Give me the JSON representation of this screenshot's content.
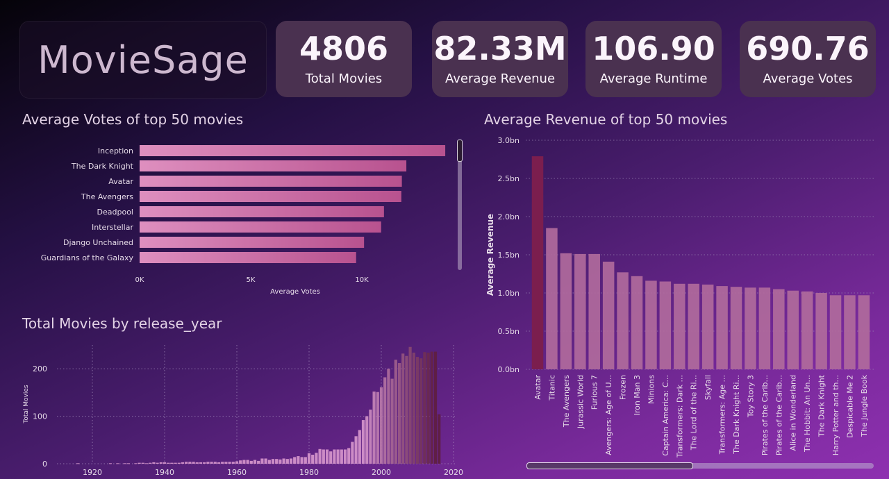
{
  "app": {
    "title": "MovieSage"
  },
  "kpis": [
    {
      "value": "4806",
      "label": "Total Movies"
    },
    {
      "value": "82.33M",
      "label": "Average Revenue"
    },
    {
      "value": "106.90",
      "label": "Average Runtime"
    },
    {
      "value": "690.76",
      "label": "Average Votes"
    }
  ],
  "colors": {
    "bar_light": "#de8fbf",
    "bar_dark": "#b8528f",
    "highlight": "#7b1e4e",
    "tick": "#e6dbe8"
  },
  "chart_data": [
    {
      "type": "bar",
      "orientation": "horizontal",
      "title": "Average Votes of top 50 movies",
      "xlabel": "Average Votes",
      "ylabel": "",
      "xlim": [
        0,
        13000
      ],
      "x_ticks": [
        "0K",
        "5K",
        "10K"
      ],
      "x_tick_values": [
        0,
        5000,
        10000
      ],
      "grid": false,
      "categories": [
        "Inception",
        "The Dark Knight",
        "Avatar",
        "The Avengers",
        "Deadpool",
        "Interstellar",
        "Django Unchained",
        "Guardians of the Galaxy"
      ],
      "values": [
        13752,
        12002,
        11800,
        11776,
        10995,
        10867,
        10099,
        9742
      ]
    },
    {
      "type": "bar",
      "title": "Average Revenue of top 50 movies",
      "xlabel": "",
      "ylabel": "Average Revenue",
      "ylim": [
        0,
        3.0
      ],
      "y_ticks": [
        "0.0bn",
        "0.5bn",
        "1.0bn",
        "1.5bn",
        "2.0bn",
        "2.5bn",
        "3.0bn"
      ],
      "grid": true,
      "categories": [
        "Avatar",
        "Titanic",
        "The Avengers",
        "Jurassic World",
        "Furious 7",
        "Avengers: Age of U...",
        "Frozen",
        "Iron Man 3",
        "Minions",
        "Captain America: C...",
        "Transformers: Dark ...",
        "The Lord of the Ri...",
        "Skyfall",
        "Transformers: Age ...",
        "The Dark Knight Ri...",
        "Toy Story 3",
        "Pirates of the Carib...",
        "Pirates of the Carib...",
        "Alice in Wonderland",
        "The Hobbit: An Un...",
        "The Dark Knight",
        "Harry Potter and th...",
        "Despicable Me 2",
        "The Jungle Book"
      ],
      "values": [
        2.79,
        1.85,
        1.52,
        1.51,
        1.51,
        1.41,
        1.27,
        1.22,
        1.16,
        1.15,
        1.12,
        1.12,
        1.11,
        1.09,
        1.08,
        1.07,
        1.07,
        1.05,
        1.03,
        1.02,
        1.0,
        0.97,
        0.97,
        0.97
      ]
    },
    {
      "type": "bar",
      "title": "Total Movies by release_year",
      "xlabel": "",
      "ylabel": "Total Movies",
      "ylim": [
        0,
        250
      ],
      "xlim": [
        1910,
        2020
      ],
      "x_ticks": [
        "1920",
        "1940",
        "1960",
        "1980",
        "2000",
        "2020"
      ],
      "x_tick_values": [
        1920,
        1940,
        1960,
        1980,
        2000,
        2020
      ],
      "y_ticks": [
        "0",
        "100",
        "200"
      ],
      "y_tick_values": [
        0,
        100,
        200
      ],
      "grid": true,
      "x": [
        1916,
        1925,
        1927,
        1929,
        1930,
        1932,
        1933,
        1934,
        1935,
        1936,
        1937,
        1938,
        1939,
        1940,
        1941,
        1942,
        1943,
        1944,
        1945,
        1946,
        1947,
        1948,
        1949,
        1950,
        1951,
        1952,
        1953,
        1954,
        1955,
        1956,
        1957,
        1958,
        1959,
        1960,
        1961,
        1962,
        1963,
        1964,
        1965,
        1966,
        1967,
        1968,
        1969,
        1970,
        1971,
        1972,
        1973,
        1974,
        1975,
        1976,
        1977,
        1978,
        1979,
        1980,
        1981,
        1982,
        1983,
        1984,
        1985,
        1986,
        1987,
        1988,
        1989,
        1990,
        1991,
        1992,
        1993,
        1994,
        1995,
        1996,
        1997,
        1998,
        1999,
        2000,
        2001,
        2002,
        2003,
        2004,
        2005,
        2006,
        2007,
        2008,
        2009,
        2010,
        2011,
        2012,
        2013,
        2014,
        2015,
        2016
      ],
      "values": [
        1,
        1,
        1,
        1,
        1,
        1,
        2,
        2,
        1,
        2,
        3,
        2,
        3,
        3,
        2,
        2,
        2,
        2,
        3,
        4,
        4,
        4,
        3,
        3,
        3,
        4,
        4,
        4,
        3,
        4,
        4,
        4,
        4,
        5,
        7,
        8,
        8,
        6,
        8,
        6,
        11,
        11,
        8,
        10,
        10,
        9,
        11,
        10,
        11,
        14,
        16,
        14,
        14,
        22,
        19,
        23,
        31,
        30,
        30,
        26,
        30,
        30,
        30,
        30,
        33,
        46,
        58,
        71,
        92,
        100,
        114,
        152,
        151,
        161,
        182,
        200,
        179,
        219,
        212,
        232,
        227,
        246,
        234,
        225,
        222,
        235,
        234,
        236,
        236,
        104
      ]
    }
  ]
}
